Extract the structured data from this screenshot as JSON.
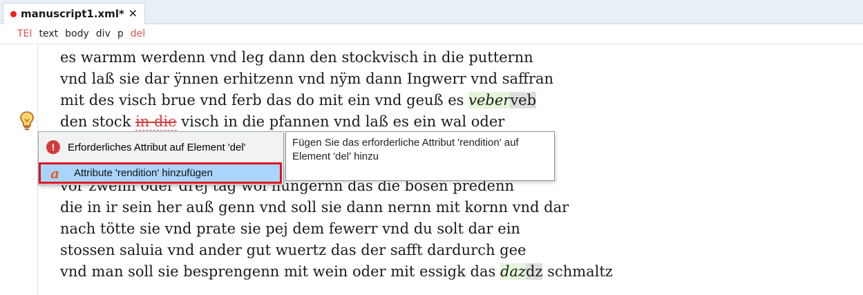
{
  "tab": {
    "title": "manuscript1.xml*",
    "close": "✕",
    "modified_color": "#e8231d"
  },
  "breadcrumb": [
    {
      "label": "TEI",
      "color": "#d9534f"
    },
    {
      "label": "text",
      "color": "#222222"
    },
    {
      "label": "body",
      "color": "#222222"
    },
    {
      "label": "div",
      "color": "#222222"
    },
    {
      "label": "p",
      "color": "#222222"
    },
    {
      "label": "del",
      "color": "#d9534f"
    }
  ],
  "editor": {
    "lines": [
      [
        {
          "t": "es warmm werdenn vnd leg dann den stockvisch in die putternn"
        }
      ],
      [
        {
          "t": "vnd laß sie dar ÿnnen erhitzenn vnd nÿm dann Ingwerr vnd saffran"
        }
      ],
      [
        {
          "t": "mit des visch brue vnd ferb das do mit ein vnd geuß es "
        },
        {
          "t": "veber",
          "c": "hl-green"
        },
        {
          "t": "veb",
          "c": "hl-gray"
        }
      ],
      [
        {
          "t": "den stock "
        },
        {
          "t": "in die",
          "c": "del-text"
        },
        {
          "t": " visch in die pfannen vnd laß es ein wal oder"
        }
      ],
      [
        {
          "t": ""
        }
      ],
      [
        {
          "t": ""
        }
      ],
      [
        {
          "t": "vor zwehn oder drej tag wol hungernn das die bosen predenn"
        }
      ],
      [
        {
          "t": "die in ir sein her auß genn vnd soll sie dann nernn mit kornn vnd dar"
        }
      ],
      [
        {
          "t": "nach tötte sie vnd prate sie pej dem fewerr vnd du solt dar ein"
        }
      ],
      [
        {
          "t": "stossen saluia vnd ander gut wuertz das der safft dardurch gee"
        }
      ],
      [
        {
          "t": "vnd man soll sie besprengenn mit wein oder mit essigk das "
        },
        {
          "t": "daz",
          "c": "hl-green"
        },
        {
          "t": "dz",
          "c": "hl-gray"
        },
        {
          "t": " schmaltz"
        }
      ]
    ]
  },
  "quick_fix": {
    "error_icon": "!",
    "error_message": "Erforderliches Attribut auf Element 'del'",
    "action_icon": "a",
    "action_label": "Attribute 'rendition' hinzufügen"
  },
  "tooltip": {
    "text": "Fügen Sie das erforderliche Attribut 'rendition' auf Element 'del' hinzu"
  }
}
